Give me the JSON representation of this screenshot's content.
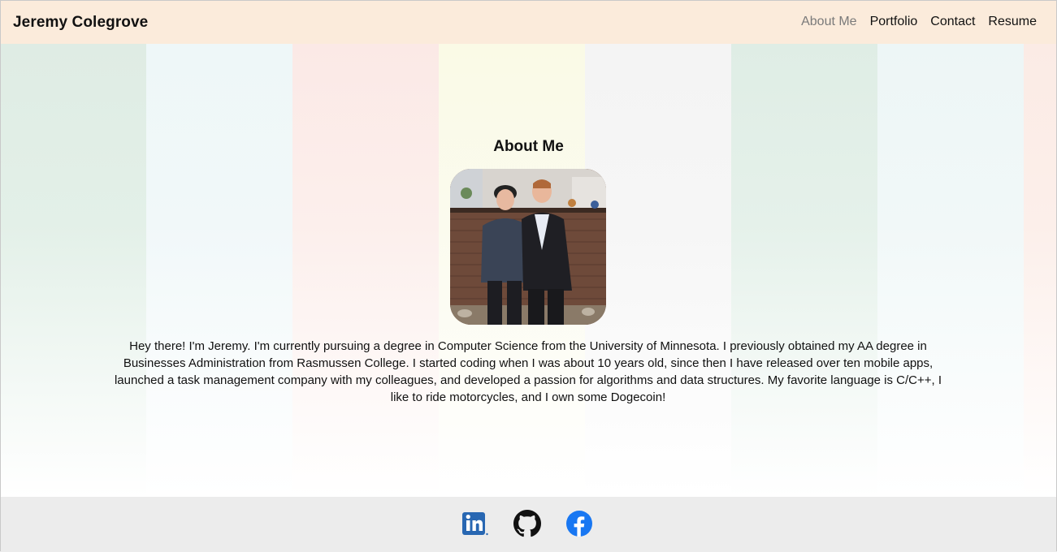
{
  "header": {
    "brand": "Jeremy Colegrove",
    "nav": [
      {
        "label": "About Me",
        "active": true
      },
      {
        "label": "Portfolio",
        "active": false
      },
      {
        "label": "Contact",
        "active": false
      },
      {
        "label": "Resume",
        "active": false
      }
    ]
  },
  "about": {
    "title": "About Me",
    "photo_alt": "Photo of Jeremy with a friend",
    "bio": "Hey there! I'm Jeremy. I'm currently pursuing a degree in Computer Science from the University of Minnesota. I previously obtained my AA degree in Businesses Administration from Rasmussen College. I started coding when I was about 10 years old, since then I have released over ten mobile apps, launched a task management company with my colleagues, and developed a passion for algorithms and data structures. My favorite language is C/C++, I like to ride motorcycles, and I own some Dogecoin!"
  },
  "footer": {
    "social_icons": [
      "linkedin-icon",
      "github-icon",
      "facebook-icon"
    ]
  },
  "colors": {
    "navbar_bg": "#fbebdb",
    "nav_active": "#7a7a7a",
    "footer_bg": "#ececec",
    "linkedin": "#2867b2",
    "facebook": "#1877f2"
  }
}
